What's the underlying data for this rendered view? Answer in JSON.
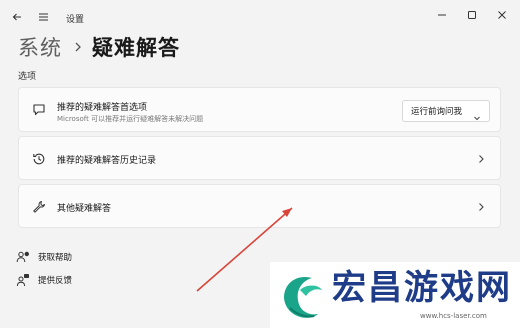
{
  "window": {
    "title": "设置"
  },
  "breadcrumb": {
    "parent": "系统",
    "current": "疑难解答"
  },
  "section_label": "选项",
  "cards": [
    {
      "title": "推荐的疑难解答首选项",
      "subtitle": "Microsoft 可以推荐并运行疑难解答未解决问题",
      "dropdown_value": "运行前询问我",
      "icon": "chat-bubble-icon"
    },
    {
      "title": "推荐的疑难解答历史记录",
      "icon": "history-icon"
    },
    {
      "title": "其他疑难解答",
      "icon": "wrench-icon"
    }
  ],
  "bottom_links": [
    {
      "label": "获取帮助",
      "icon": "help-person-icon"
    },
    {
      "label": "提供反馈",
      "icon": "feedback-person-icon"
    }
  ],
  "watermark": {
    "brand": "宏昌游戏网",
    "url": "www.hcs-laser.com"
  },
  "colors": {
    "background": "#f3f3f3",
    "card": "#fbfbfb",
    "annotation_arrow": "#d9453a",
    "watermark_text": "#1f3c88",
    "watermark_logo": "#1aa58a"
  }
}
